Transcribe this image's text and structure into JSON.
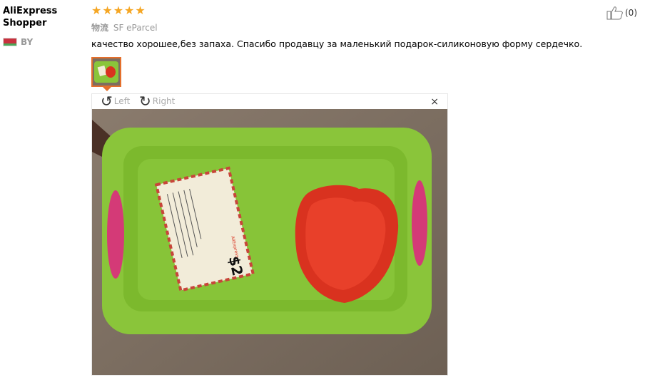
{
  "reviewer": {
    "name": "AliExpress Shopper",
    "country_code": "BY"
  },
  "rating": {
    "stars": 5,
    "star_color": "#f5a623"
  },
  "logistics": {
    "label": "物流",
    "value": "SF eParcel"
  },
  "feedback": {
    "text": "качество хорошее,без запаха. Спасибо продавцу за маленький подарок-силиконовую форму сердечко."
  },
  "viewer": {
    "rotate_left_label": "Left",
    "rotate_right_label": "Right",
    "close_glyph": "×"
  },
  "photo": {
    "card_text": "$2",
    "card_brand": "AliExpress"
  },
  "helpful": {
    "count_text": "(0)"
  },
  "icons": {
    "thumbs_up": "thumbs-up-icon",
    "rotate_left": "rotate-left-icon",
    "rotate_right": "rotate-right-icon",
    "close": "close-icon"
  },
  "colors": {
    "accent": "#e46f2c",
    "tray_green": "#8ac53a",
    "heart_red": "#d9321f",
    "handle_pink": "#d43a77"
  }
}
